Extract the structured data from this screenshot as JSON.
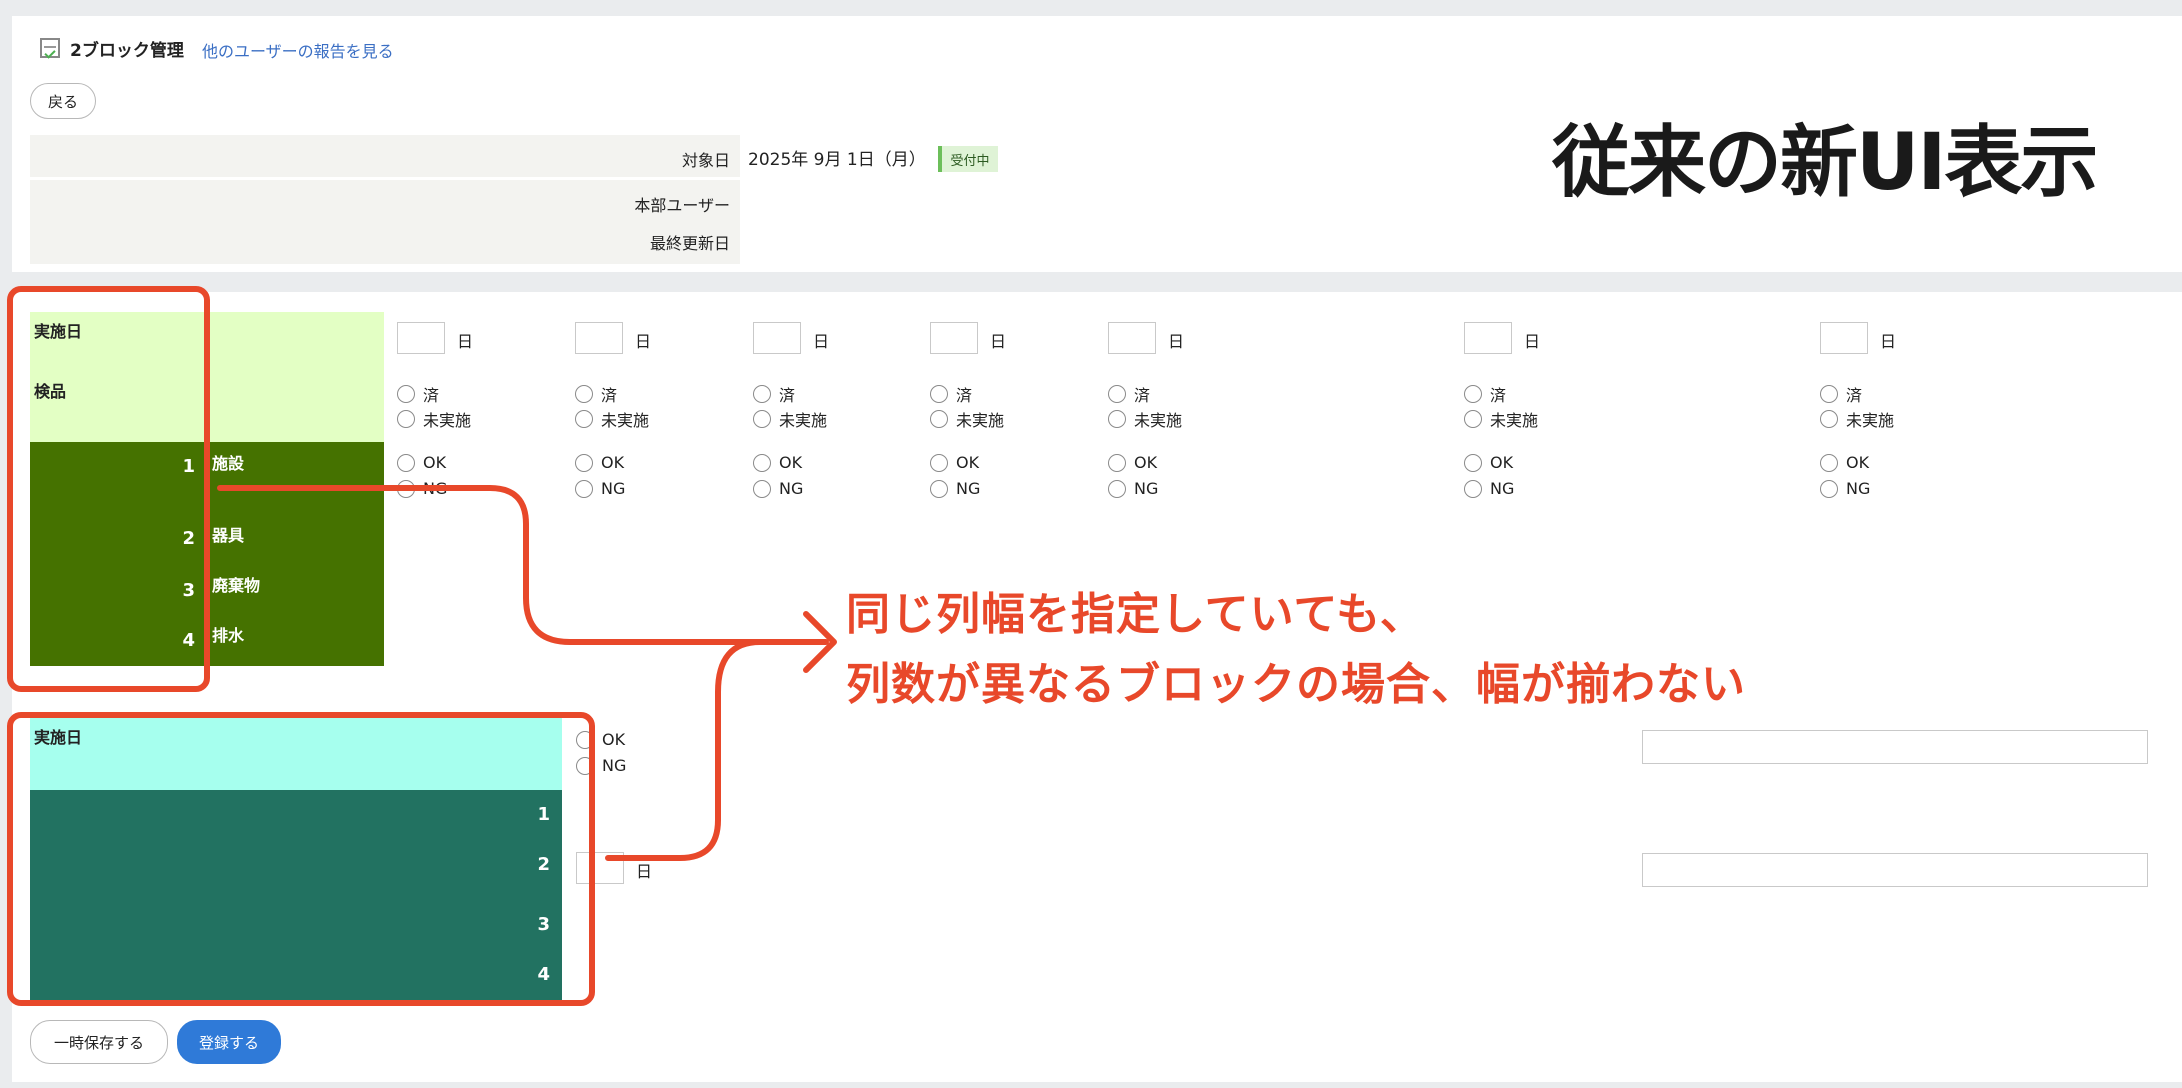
{
  "header": {
    "title": "2ブロック管理",
    "link": "他のユーザーの報告を見る",
    "back_label": "戻る"
  },
  "info": {
    "target_date_label": "対象日",
    "target_date_value": "2025年 9月 1日（月）",
    "status_badge": "受付中",
    "hq_user_label": "本部ユーザー",
    "last_updated_label": "最終更新日"
  },
  "overlay_title": "従来の新UI表示",
  "block1": {
    "impl_day_label": "実施日",
    "inspection_label": "検品",
    "rows": [
      {
        "num": "1",
        "label": "施設"
      },
      {
        "num": "2",
        "label": "器具"
      },
      {
        "num": "3",
        "label": "廃棄物"
      },
      {
        "num": "4",
        "label": "排水"
      }
    ],
    "day_unit": "日",
    "done_label": "済",
    "not_done_label": "未実施",
    "ok_label": "OK",
    "ng_label": "NG"
  },
  "block2": {
    "impl_day_label": "実施日",
    "rows": [
      "1",
      "2",
      "3",
      "4"
    ],
    "ok_label": "OK",
    "ng_label": "NG",
    "day_unit": "日"
  },
  "annotation": {
    "line1": "同じ列幅を指定していても、",
    "line2": "列数が異なるブロックの場合、幅が揃わない"
  },
  "buttons": {
    "temp_save": "一時保存する",
    "register": "登録する"
  },
  "colors": {
    "accent_annotation": "#e8482a",
    "block1_light": "#e3ffc4",
    "block1_dark": "#457200",
    "block2_light": "#a6ffee",
    "block2_dark": "#227261",
    "primary_button": "#2f7ad8",
    "link": "#3b6fc4"
  }
}
